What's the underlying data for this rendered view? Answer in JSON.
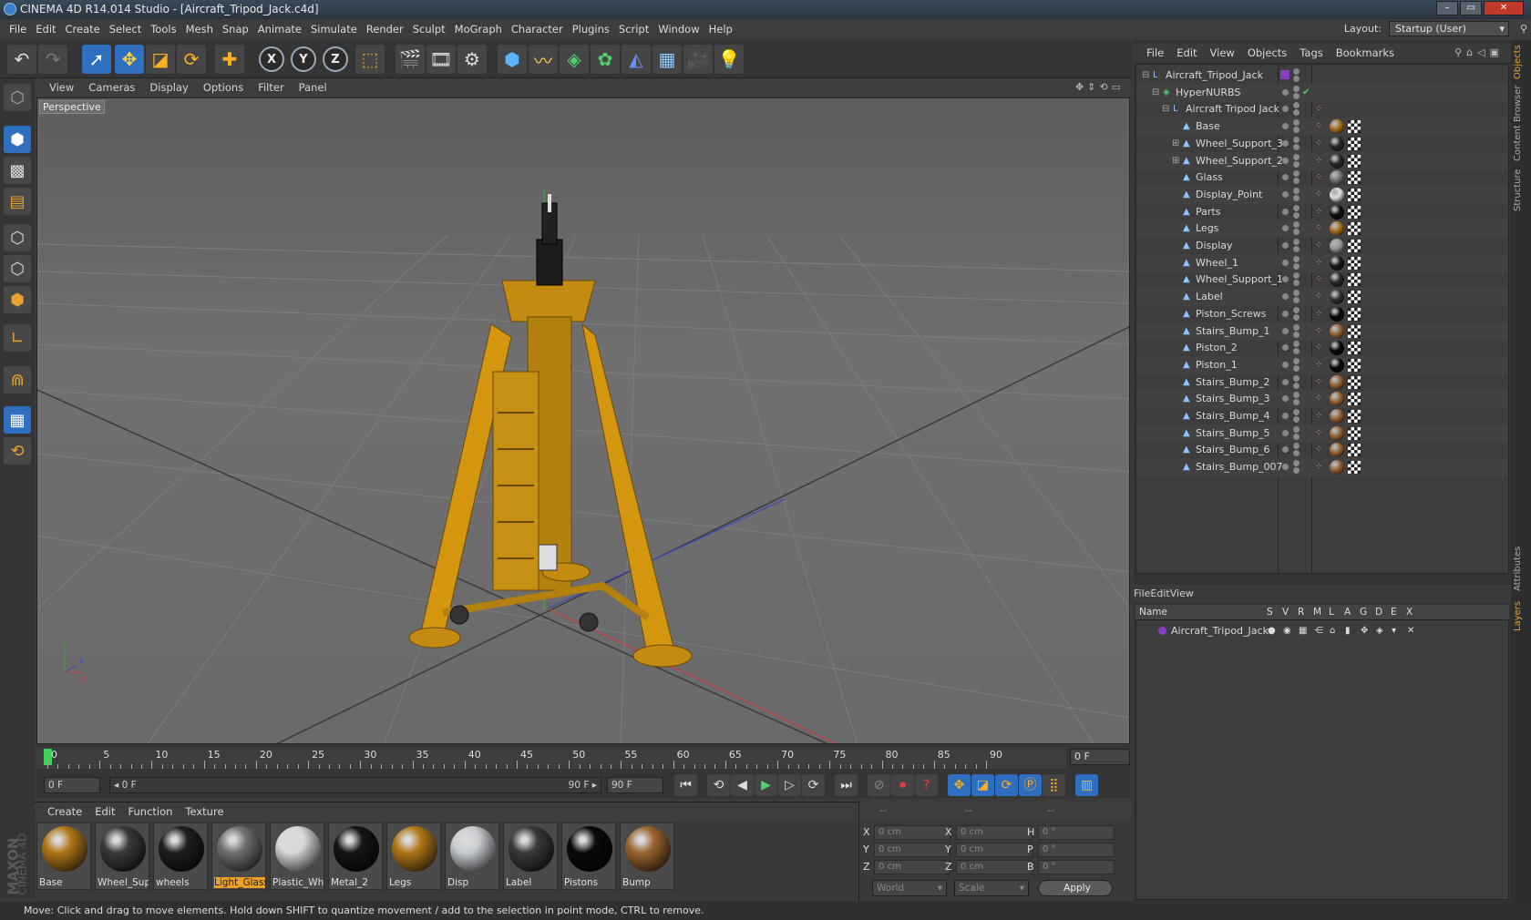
{
  "window": {
    "title": "CINEMA 4D R14.014 Studio - [Aircraft_Tripod_Jack.c4d]"
  },
  "menubar": {
    "items": [
      "File",
      "Edit",
      "Create",
      "Select",
      "Tools",
      "Mesh",
      "Snap",
      "Animate",
      "Simulate",
      "Render",
      "Sculpt",
      "MoGraph",
      "Character",
      "Plugins",
      "Script",
      "Window",
      "Help"
    ],
    "layout_label": "Layout:",
    "layout_value": "Startup (User)"
  },
  "viewport": {
    "menu": [
      "View",
      "Cameras",
      "Display",
      "Options",
      "Filter",
      "Panel"
    ],
    "label": "Perspective",
    "axis": {
      "x": "x",
      "y": "y",
      "z": "z"
    }
  },
  "timeline": {
    "ticks": [
      "0",
      "5",
      "10",
      "15",
      "20",
      "25",
      "30",
      "35",
      "40",
      "45",
      "50",
      "55",
      "60",
      "65",
      "70",
      "75",
      "80",
      "85",
      "90"
    ],
    "current_frame": "0 F"
  },
  "transport": {
    "start_field": "0 F",
    "range_left": "◂ 0 F",
    "range_right": "90 F ▸",
    "end_field": "90 F"
  },
  "materials": {
    "menu": [
      "Create",
      "Edit",
      "Function",
      "Texture"
    ],
    "items": [
      {
        "label": "Base",
        "color": "#b07818"
      },
      {
        "label": "Wheel_Sup",
        "color": "#3a3a3a"
      },
      {
        "label": "wheels",
        "color": "#1e1e1e"
      },
      {
        "label": "Light_Glass",
        "color": "#707070",
        "selected": true
      },
      {
        "label": "Plastic_Wh",
        "color": "#d8d8d8"
      },
      {
        "label": "Metal_2",
        "color": "#151515"
      },
      {
        "label": "Legs",
        "color": "#b07818"
      },
      {
        "label": "Disp",
        "color": "#c8ccd0"
      },
      {
        "label": "Label",
        "color": "#3a3a3a"
      },
      {
        "label": "Pistons",
        "color": "#0a0a0a"
      },
      {
        "label": "Bump",
        "color": "#9a6430"
      }
    ]
  },
  "coords": {
    "header": [
      "--",
      "--",
      "--"
    ],
    "rows": [
      {
        "a_label": "X",
        "a_val": "0 cm",
        "b_label": "X",
        "b_val": "0 cm",
        "c_label": "H",
        "c_val": "0 °"
      },
      {
        "a_label": "Y",
        "a_val": "0 cm",
        "b_label": "Y",
        "b_val": "0 cm",
        "c_label": "P",
        "c_val": "0 °"
      },
      {
        "a_label": "Z",
        "a_val": "0 cm",
        "b_label": "Z",
        "b_val": "0 cm",
        "c_label": "B",
        "c_val": "0 °"
      }
    ],
    "space": "World",
    "mode": "Scale",
    "apply": "Apply"
  },
  "objects": {
    "menu": [
      "File",
      "Edit",
      "View",
      "Objects",
      "Tags",
      "Bookmarks"
    ],
    "items": [
      {
        "name": "Aircraft_Tripod_Jack",
        "level": 0,
        "kind": "null"
      },
      {
        "name": "HyperNURBS",
        "level": 1,
        "kind": "nurbs"
      },
      {
        "name": "Aircraft Tripod Jack",
        "level": 2,
        "kind": "null"
      },
      {
        "name": "Base",
        "level": 3,
        "kind": "poly",
        "mat": "#a87018"
      },
      {
        "name": "Wheel_Support_3",
        "level": 3,
        "kind": "poly",
        "mat": "#2a2a2a"
      },
      {
        "name": "Wheel_Support_2",
        "level": 3,
        "kind": "poly",
        "mat": "#2a2a2a"
      },
      {
        "name": "Glass",
        "level": 3,
        "kind": "poly",
        "mat": "#777"
      },
      {
        "name": "Display_Point",
        "level": 3,
        "kind": "poly",
        "mat": "#ddd"
      },
      {
        "name": "Parts",
        "level": 3,
        "kind": "poly",
        "mat": "#111"
      },
      {
        "name": "Legs",
        "level": 3,
        "kind": "poly",
        "mat": "#a87018"
      },
      {
        "name": "Display",
        "level": 3,
        "kind": "poly",
        "mat": "#999"
      },
      {
        "name": "Wheel_1",
        "level": 3,
        "kind": "poly",
        "mat": "#1a1a1a"
      },
      {
        "name": "Wheel_Support_1",
        "level": 3,
        "kind": "poly",
        "mat": "#2a2a2a"
      },
      {
        "name": "Label",
        "level": 3,
        "kind": "poly",
        "mat": "#333"
      },
      {
        "name": "Piston_Screws",
        "level": 3,
        "kind": "poly",
        "mat": "#0a0a0a"
      },
      {
        "name": "Stairs_Bump_1",
        "level": 3,
        "kind": "poly",
        "mat": "#9a6430"
      },
      {
        "name": "Piston_2",
        "level": 3,
        "kind": "poly",
        "mat": "#0a0a0a"
      },
      {
        "name": "Piston_1",
        "level": 3,
        "kind": "poly",
        "mat": "#0a0a0a"
      },
      {
        "name": "Stairs_Bump_2",
        "level": 3,
        "kind": "poly",
        "mat": "#9a6430"
      },
      {
        "name": "Stairs_Bump_3",
        "level": 3,
        "kind": "poly",
        "mat": "#9a6430"
      },
      {
        "name": "Stairs_Bump_4",
        "level": 3,
        "kind": "poly",
        "mat": "#9a6430"
      },
      {
        "name": "Stairs_Bump_5",
        "level": 3,
        "kind": "poly",
        "mat": "#9a6430"
      },
      {
        "name": "Stairs_Bump_6",
        "level": 3,
        "kind": "poly",
        "mat": "#9a6430"
      },
      {
        "name": "Stairs_Bump_007",
        "level": 3,
        "kind": "poly",
        "mat": "#9a6430"
      }
    ]
  },
  "layers": {
    "menu": [
      "File",
      "Edit",
      "View"
    ],
    "columns": [
      "Name",
      "S",
      "V",
      "R",
      "M",
      "L",
      "A",
      "G",
      "D",
      "E",
      "X"
    ],
    "items": [
      {
        "name": "Aircraft_Tripod_Jack",
        "color": "#8a3ec8"
      }
    ]
  },
  "side_tabs": [
    "Objects",
    "Content Browser",
    "Structure",
    "Attributes",
    "Layers"
  ],
  "status": "Move: Click and drag to move elements. Hold down SHIFT to quantize movement / add to the selection in point mode, CTRL to remove.",
  "brand": {
    "line1": "MAXON",
    "line2": "CINEMA 4D"
  }
}
